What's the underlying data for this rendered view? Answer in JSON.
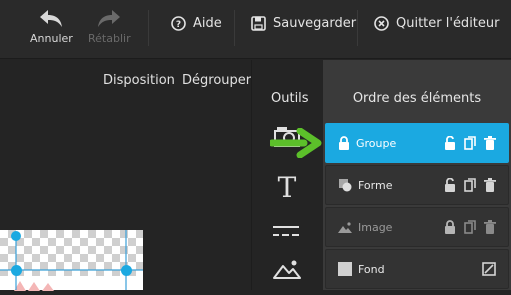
{
  "toolbar": {
    "undo_label": "Annuler",
    "redo_label": "Rétablir",
    "help_label": "Aide",
    "save_label": "Sauvegarder",
    "quit_label": "Quitter l'éditeur"
  },
  "canvas_menu": {
    "layout_label": "Disposition",
    "ungroup_label": "Dégrouper"
  },
  "tools": {
    "title": "Outils"
  },
  "layers": {
    "title": "Ordre des éléments",
    "items": [
      {
        "label": "Groupe",
        "icon": "lock-icon",
        "state": "selected"
      },
      {
        "label": "Forme",
        "icon": "shape-icon",
        "state": "normal"
      },
      {
        "label": "Image",
        "icon": "image-icon",
        "state": "locked"
      },
      {
        "label": "Fond",
        "icon": "background-icon",
        "state": "normal"
      }
    ]
  },
  "colors": {
    "accent": "#1ba9e1",
    "arrow": "#5cbf2a",
    "panel": "#3a3a3a",
    "background": "#242424"
  }
}
